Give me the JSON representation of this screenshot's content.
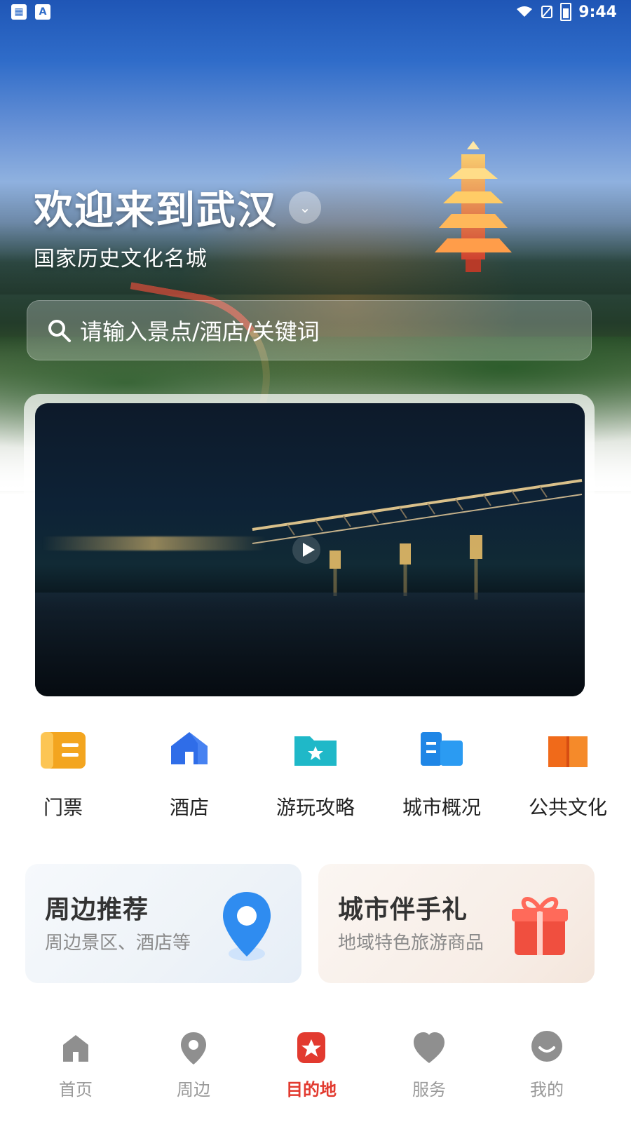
{
  "status_bar": {
    "time": "9:44",
    "left_icons": [
      "image-icon",
      "a-icon"
    ],
    "right_icons": [
      "wifi-icon",
      "no-sim-icon",
      "battery-charging-icon"
    ]
  },
  "hero": {
    "title": "欢迎来到武汉",
    "subtitle": "国家历史文化名城"
  },
  "search": {
    "placeholder": "请输入景点/酒店/关键词"
  },
  "quick_entries": [
    {
      "label": "门票",
      "icon": "ticket-icon",
      "color": "#f3a51f"
    },
    {
      "label": "酒店",
      "icon": "hotel-icon",
      "color": "#2f6de8"
    },
    {
      "label": "游玩攻略",
      "icon": "guide-icon",
      "color": "#1fb8c8"
    },
    {
      "label": "城市概况",
      "icon": "city-overview-icon",
      "color": "#1f86e6"
    },
    {
      "label": "公共文化",
      "icon": "culture-icon",
      "color": "#f06a1a"
    }
  ],
  "cards": [
    {
      "title": "周边推荐",
      "subtitle": "周边景区、酒店等",
      "icon": "location-pin-icon",
      "accent": "#2f8cf0"
    },
    {
      "title": "城市伴手礼",
      "subtitle": "地域特色旅游商品",
      "icon": "gift-icon",
      "accent": "#f04f3f"
    }
  ],
  "tabbar": {
    "items": [
      {
        "label": "首页",
        "icon": "home-icon"
      },
      {
        "label": "周边",
        "icon": "pin-icon"
      },
      {
        "label": "目的地",
        "icon": "destination-icon"
      },
      {
        "label": "服务",
        "icon": "heart-icon"
      },
      {
        "label": "我的",
        "icon": "profile-icon"
      }
    ],
    "active_index": 2,
    "active_color": "#e23a2f",
    "inactive_color": "#9a9a9a"
  }
}
